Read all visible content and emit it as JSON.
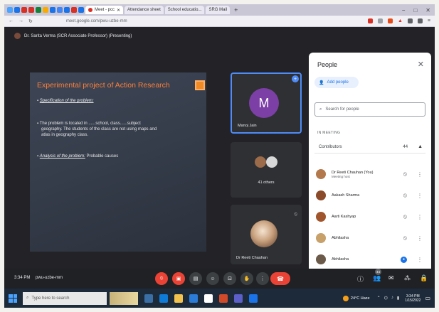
{
  "browser": {
    "tabs": [
      {
        "label": "Meet ‑ pcc",
        "active": true
      },
      {
        "label": "Attendance sheet",
        "active": false
      },
      {
        "label": "School educatio...",
        "active": false
      },
      {
        "label": "SRG Mail",
        "active": false
      }
    ],
    "new_tab": "+",
    "url": "meet.google.com/pwu-uzbe-mm",
    "window_controls": [
      "−",
      "□",
      "✕"
    ]
  },
  "presenter_label": "Dr. Sarita Verma (SCR Associate Professor) (Presenting)",
  "slide": {
    "title": "Experimental project of Action Research",
    "spec_heading": "Specification of the problem:",
    "spec_body_1": "The problem is located in ......school, class......subject",
    "spec_body_2": "geography. The students of the class are not using maps and",
    "spec_body_3": "atlas in geography class.",
    "analysis_heading": "Analysis of the problem:",
    "analysis_body": "Probable causes"
  },
  "tiles": {
    "tile1": {
      "initial": "M",
      "name": "Manoj Jain",
      "avatar_color": "#7b3fa6"
    },
    "tile2": {
      "label": "41 others"
    },
    "tile3": {
      "name": "Dr Reeti Chauhan"
    }
  },
  "people_panel": {
    "title": "People",
    "add_people": "Add people",
    "search_placeholder": "Search for people",
    "section": "IN MEETING",
    "group": "Contributors",
    "group_count": "44",
    "people": [
      {
        "name": "Dr Reeti Chauhan (You)",
        "sub": "Meeting host",
        "color": "#b3794c"
      },
      {
        "name": "Aakash Sharma",
        "sub": "",
        "color": "#8b4a2a"
      },
      {
        "name": "Aarti Kashyap",
        "sub": "",
        "color": "#a0552c"
      },
      {
        "name": "Abhilasha",
        "sub": "",
        "color": "#c7a06a"
      },
      {
        "name": "Abhilasha",
        "sub": "",
        "color": "#6b5a4a"
      }
    ]
  },
  "meet_bar": {
    "time": "3:34 PM",
    "code": "pwu-uzbe-mm",
    "people_count": "44"
  },
  "taskbar": {
    "search_placeholder": "Type here to search",
    "weather": "24°C Haze",
    "clock_time": "3:34 PM",
    "clock_date": "1/15/2022"
  }
}
